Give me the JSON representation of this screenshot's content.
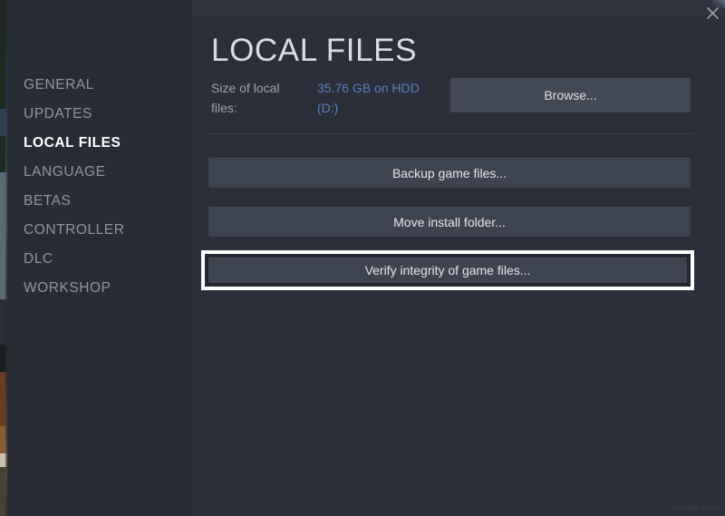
{
  "window": {
    "close_icon": "close-icon"
  },
  "sidebar": {
    "items": [
      {
        "label": "GENERAL",
        "active": false
      },
      {
        "label": "UPDATES",
        "active": false
      },
      {
        "label": "LOCAL FILES",
        "active": true
      },
      {
        "label": "LANGUAGE",
        "active": false
      },
      {
        "label": "BETAS",
        "active": false
      },
      {
        "label": "CONTROLLER",
        "active": false
      },
      {
        "label": "DLC",
        "active": false
      },
      {
        "label": "WORKSHOP",
        "active": false
      }
    ]
  },
  "main": {
    "title": "LOCAL FILES",
    "size_row": {
      "label": "Size of local files:",
      "value": "35.76 GB on HDD (D:)",
      "browse_label": "Browse..."
    },
    "actions": [
      {
        "label": "Backup game files...",
        "focused": false
      },
      {
        "label": "Move install folder...",
        "focused": false
      },
      {
        "label": "Verify integrity of game files...",
        "focused": true
      }
    ]
  },
  "watermark": "wsxdn.com",
  "colors": {
    "panel_bg": "#2b2f39",
    "sidebar_bg": "#282c35",
    "button_bg": "#3e4350",
    "browse_bg": "#434855",
    "link_blue": "#5a7ec4",
    "active_text": "#ffffff",
    "muted_text": "#8f949d",
    "focus_ring": "#ffffff"
  }
}
